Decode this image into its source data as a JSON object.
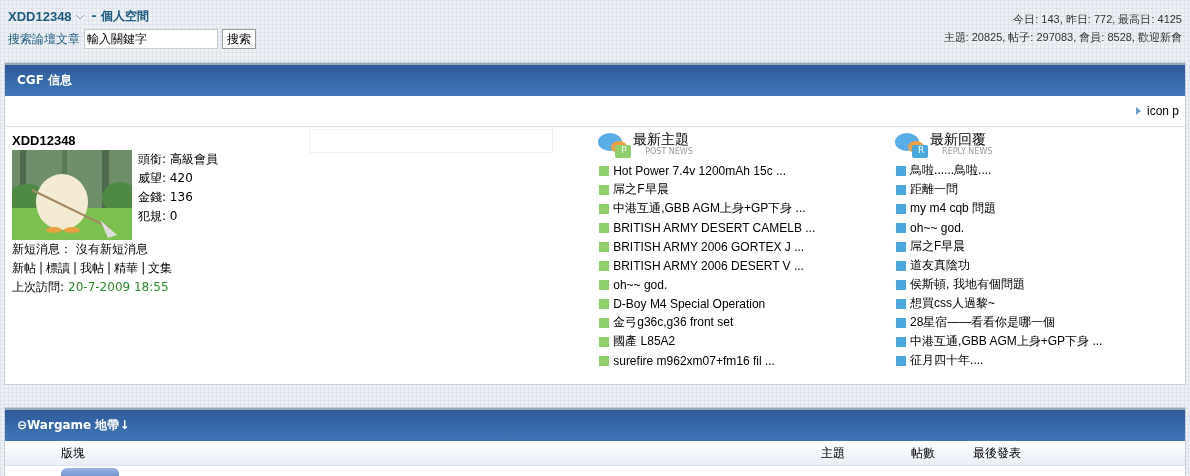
{
  "header": {
    "username": "XDD12348",
    "space_link": "- 個人空間",
    "search_label": "搜索論壇文章",
    "search": {
      "value": "輸入關鍵字"
    },
    "search_button": "搜索",
    "stats_line_1": "今日: 143, 昨日: 772, 最高日: 4125",
    "stats_line_2": "主題: 20825, 帖子: 297083, 會員: 8528, 歡迎新會"
  },
  "info_panel": {
    "title": "CGF 信息",
    "legend": "icon p",
    "user": {
      "name": "XDD12348",
      "avatar": {
        "kind": "picture"
      },
      "fields": [
        "頭銜: 高級會員",
        "威望: 420",
        "金錢: 136",
        "犯規: 0"
      ],
      "messages": "新短消息： 沒有新短消息",
      "links": [
        "新帖",
        "標讀",
        "我帖",
        "精華",
        "文集"
      ],
      "link_separator": "|",
      "last_visit_label": "上次訪問:",
      "last_visit": "20-7-2009 18:55"
    },
    "lists": [
      {
        "title": "最新主題",
        "subtitle": "POST NEWS",
        "badge": "P",
        "color": "#8fd06a",
        "items": [
          "Hot Power 7.4v 1200mAh 15c ...",
          "屌之F早晨",
          "中港互通,GBB AGM上身+GP下身 ...",
          "BRITISH ARMY DESERT CAMELB ...",
          "BRITISH ARMY 2006 GORTEX J ...",
          "BRITISH ARMY 2006 DESERT V ...",
          "oh~~ god.",
          "D-Boy M4 Special Operation",
          "金弓g36c,g36 front set",
          "國產 L85A2",
          "surefire m962xm07+fm16 fil ..."
        ]
      },
      {
        "title": "最新回覆",
        "subtitle": "REPLY NEWS",
        "badge": "R",
        "color": "#4aa8e0",
        "items": [
          "鳥啦......鳥啦....",
          "距離一問",
          "my m4 cqb 問題",
          "oh~~ god.",
          "屌之F早晨",
          "道友真陰功",
          "侯斯頓, 我地有個問題",
          "想買css人過黎~",
          "28星宿——看看你是哪一個",
          "中港互通,GBB AGM上身+GP下身 ...",
          "征月四十年...."
        ]
      }
    ]
  },
  "forum_panel": {
    "title": "⊖Wargame 地帶↓",
    "columns": [
      "版塊",
      "主題",
      "帖數",
      "最後發表"
    ]
  }
}
